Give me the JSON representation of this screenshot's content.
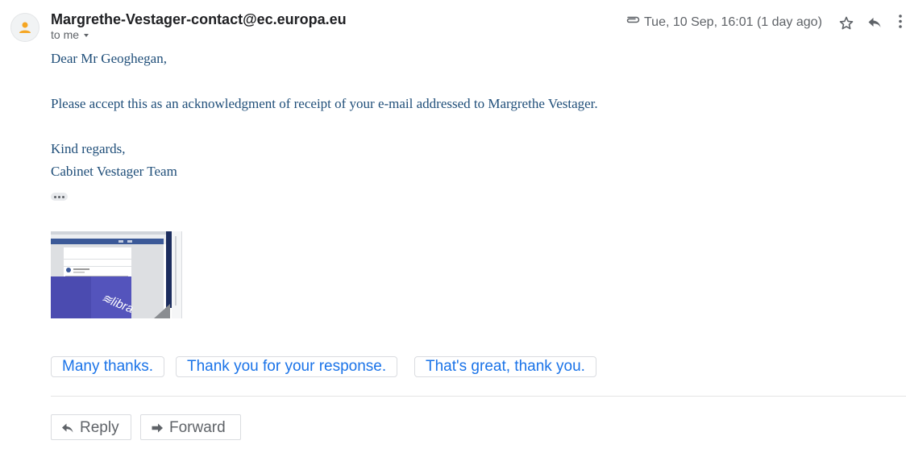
{
  "header": {
    "sender": "Margrethe-Vestager-contact@ec.europa.eu",
    "recipient": "to me",
    "timestamp": "Tue, 10 Sep, 16:01 (1 day ago)",
    "icons": [
      "person-icon",
      "paperclip-icon",
      "star-icon",
      "reply-icon",
      "more-vert-icon"
    ]
  },
  "body": {
    "greeting": "Dear Mr Geoghegan,",
    "paragraph": "Please accept this as an acknowledgment of receipt of your e-mail addressed to Margrethe Vestager.",
    "closing": "Kind regards,",
    "signature": "Cabinet Vestager Team"
  },
  "attachment": {
    "thumbnail_logo": "libra"
  },
  "smart_replies": [
    "Many thanks.",
    "Thank you for your response.",
    "That's great, thank you."
  ],
  "actions": {
    "reply_label": "Reply",
    "forward_label": "Forward"
  },
  "colors": {
    "body_text": "#1f4e79",
    "link_blue": "#1a73e8",
    "avatar_accent": "#f5a623",
    "libra_purple": "#4b4bb0"
  }
}
